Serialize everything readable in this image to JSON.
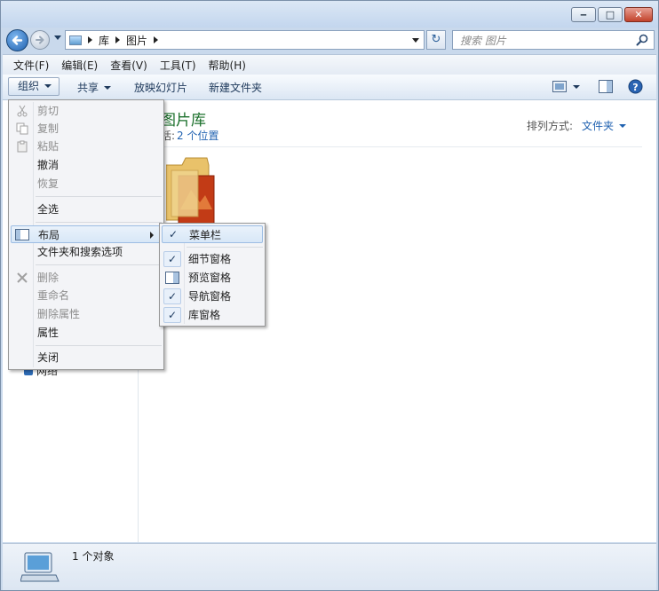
{
  "address": {
    "segments": [
      "库",
      "图片"
    ],
    "search_placeholder": "搜索 图片"
  },
  "menubar": {
    "items": [
      "文件(F)",
      "编辑(E)",
      "查看(V)",
      "工具(T)",
      "帮助(H)"
    ]
  },
  "toolbar": {
    "organize": "组织",
    "share": "共享",
    "slideshow": "放映幻灯片",
    "new_folder": "新建文件夹"
  },
  "library": {
    "title": "图片库",
    "includes_label": "括:",
    "includes_link": "2 个位置",
    "arrange_label": "排列方式:",
    "arrange_value": "文件夹"
  },
  "navpane": {
    "network": "网络"
  },
  "organize_menu": {
    "cut": "剪切",
    "copy": "复制",
    "paste": "粘贴",
    "undo": "撤消",
    "redo": "恢复",
    "select_all": "全选",
    "layout": "布局",
    "folder_options": "文件夹和搜索选项",
    "delete": "删除",
    "rename": "重命名",
    "remove_props": "删除属性",
    "properties": "属性",
    "close": "关闭"
  },
  "layout_submenu": {
    "menubar": "菜单栏",
    "details_pane": "细节窗格",
    "preview_pane": "预览窗格",
    "nav_pane": "导航窗格",
    "library_pane": "库窗格"
  },
  "status": {
    "count": "1 个对象"
  },
  "colors": {
    "link": "#1f61b0",
    "library_title": "#1a6f2a",
    "close_button": "#c2422b"
  }
}
